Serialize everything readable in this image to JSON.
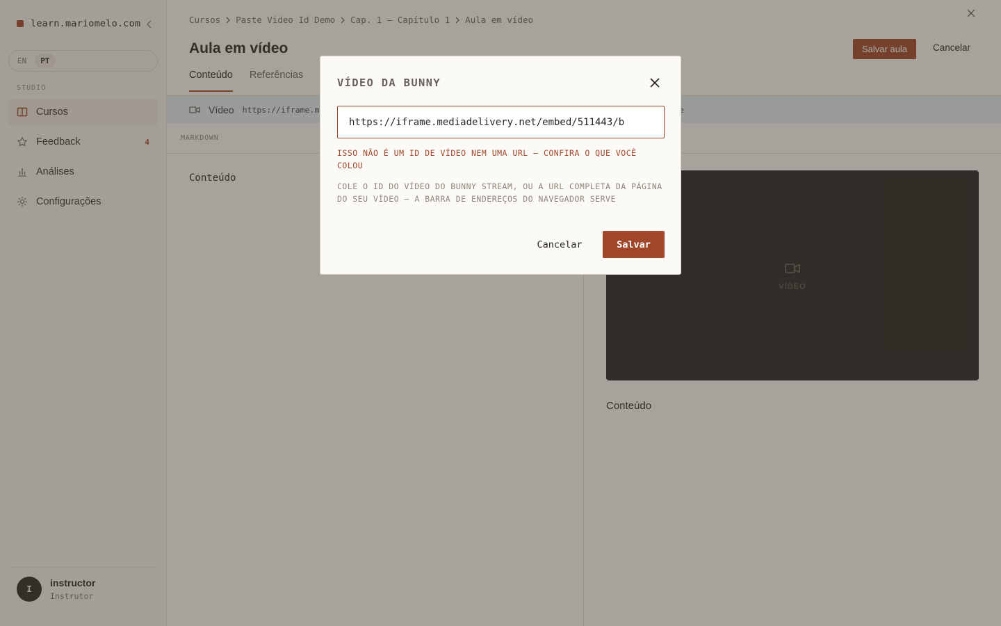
{
  "sidebar": {
    "brand": "learn.mariomelo.com",
    "lang": [
      "EN",
      "PT"
    ],
    "lang_active": "PT",
    "section_label": "STUDIO",
    "items": [
      {
        "label": "Cursos",
        "icon": "book-icon"
      },
      {
        "label": "Feedback",
        "icon": "star-icon",
        "badge": "4"
      },
      {
        "label": "Análises",
        "icon": "bar-chart-icon"
      },
      {
        "label": "Configurações",
        "icon": "gear-icon"
      }
    ],
    "user": {
      "initial": "I",
      "name": "instructor",
      "role": "Instrutor"
    }
  },
  "breadcrumb": [
    "Cursos",
    "Paste Video Id Demo",
    "Cap. 1 — Capítulo 1",
    "Aula em vídeo"
  ],
  "page": {
    "title": "Aula em vídeo",
    "save_label": "Salvar aula",
    "cancel_label": "Cancelar",
    "tabs": [
      "Conteúdo",
      "Referências"
    ],
    "video_bar": {
      "label": "Vídeo",
      "url_prefix": "https://iframe.med",
      "url_suffix": "e"
    },
    "editor_label": "MARKDOWN",
    "editor_text": "Conteúdo",
    "preview_video_label": "VÍDEO",
    "preview_text": "Conteúdo"
  },
  "modal": {
    "title": "VÍDEO DA BUNNY",
    "input_value": "https://iframe.mediadelivery.net/embed/511443/b",
    "error": "ISSO NÃO É UM ID DE VÍDEO NEM UMA URL — CONFIRA O QUE VOCÊ COLOU",
    "help": "COLE O ID DO VÍDEO DO BUNNY STREAM, OU A URL COMPLETA DA PÁGINA DO SEU VÍDEO — A BARRA DE ENDEREÇOS DO NAVEGADOR SERVE",
    "cancel": "Cancelar",
    "save": "Salvar"
  },
  "colors": {
    "accent": "#a0472a",
    "sidebar_bg": "#f4efe7",
    "video_bg": "#2a2522",
    "overlay": "rgba(62,56,48,0.44)"
  }
}
